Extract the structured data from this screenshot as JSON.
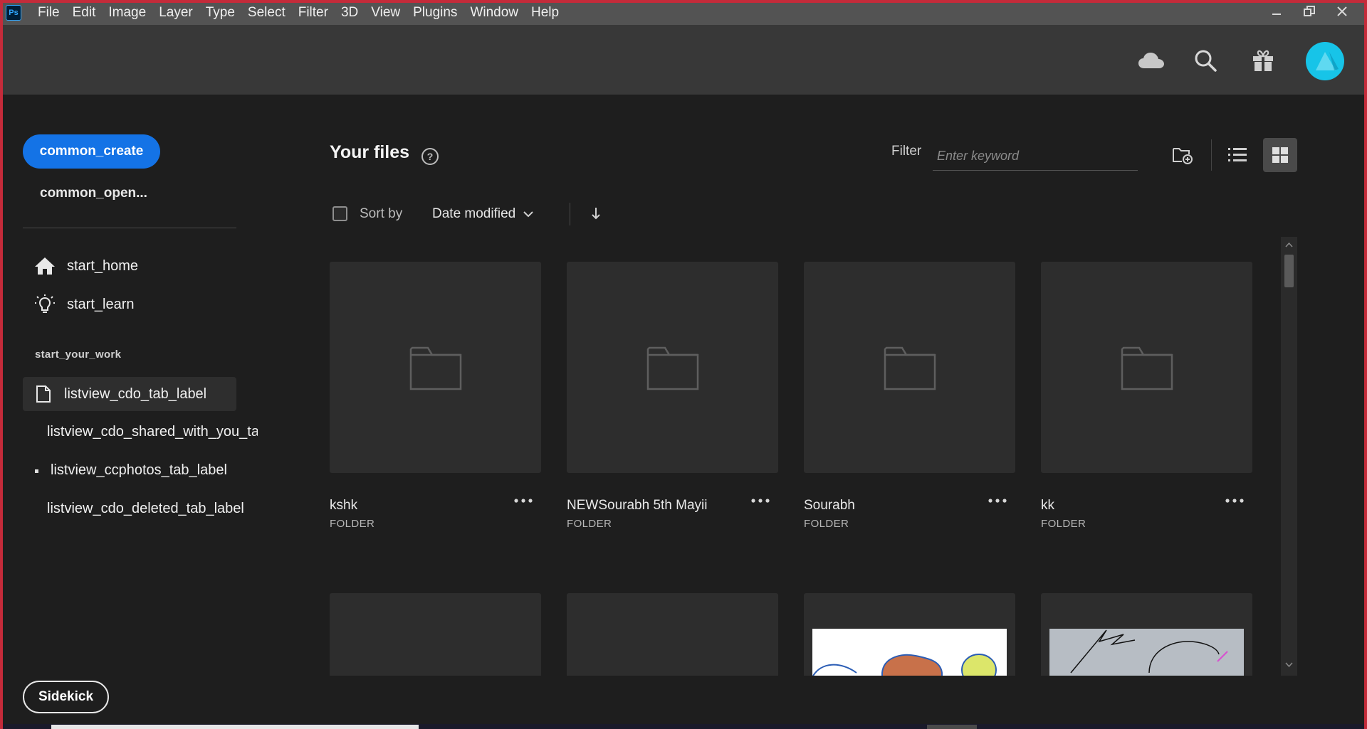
{
  "menubar": {
    "app_logo": "Ps",
    "items": [
      "File",
      "Edit",
      "Image",
      "Layer",
      "Type",
      "Select",
      "Filter",
      "3D",
      "View",
      "Plugins",
      "Window",
      "Help"
    ]
  },
  "header": {
    "icons": [
      "cloud-icon",
      "search-icon",
      "gift-icon"
    ]
  },
  "sidebar": {
    "create_label": "common_create",
    "open_label": "common_open...",
    "nav": [
      {
        "label": "start_home",
        "icon": "home-icon"
      },
      {
        "label": "start_learn",
        "icon": "lightbulb-icon"
      }
    ],
    "section_label": "start_your_work",
    "tabs": [
      {
        "label": "listview_cdo_tab_label",
        "icon": "document-icon"
      },
      {
        "label": "listview_cdo_shared_with_you_tal"
      },
      {
        "label": "listview_ccphotos_tab_label"
      },
      {
        "label": "listview_cdo_deleted_tab_label"
      }
    ],
    "sidekick_label": "Sidekick"
  },
  "main": {
    "title": "Your files",
    "filter_label": "Filter",
    "filter_placeholder": "Enter keyword",
    "sort_label": "Sort by",
    "sort_value": "Date modified",
    "files": [
      {
        "name": "kshk",
        "type": "FOLDER"
      },
      {
        "name": "NEWSourabh 5th Mayii",
        "type": "FOLDER"
      },
      {
        "name": "Sourabh",
        "type": "FOLDER"
      },
      {
        "name": "kk",
        "type": "FOLDER"
      }
    ]
  },
  "colors": {
    "accent": "#1473e6",
    "avatar": "#17c4e8",
    "window_border": "#c42b3a"
  }
}
